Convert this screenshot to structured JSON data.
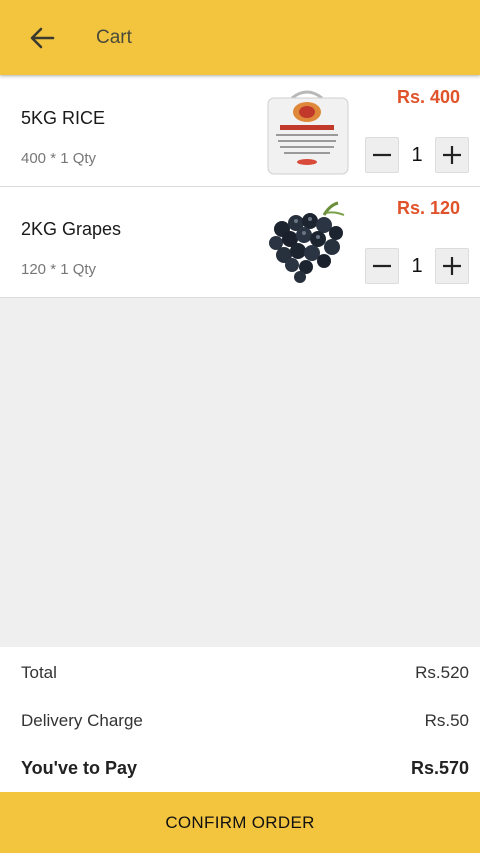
{
  "header": {
    "title": "Cart",
    "back_icon": "arrow-left-icon",
    "background_color": "#f3c53f"
  },
  "cart": {
    "items": [
      {
        "name": "5KG RICE",
        "qty_line": "400 * 1 Qty",
        "price": "Rs. 400",
        "quantity": "1",
        "image_icon": "rice-bag-image"
      },
      {
        "name": "2KG Grapes",
        "qty_line": "120 * 1 Qty",
        "price": "Rs. 120",
        "quantity": "1",
        "image_icon": "grapes-image"
      }
    ],
    "price_color": "#e0522a"
  },
  "summary": {
    "total_label": "Total",
    "total_value": "Rs.520",
    "delivery_label": "Delivery Charge",
    "delivery_value": "Rs.50",
    "pay_label": "You've to Pay",
    "pay_value": "Rs.570"
  },
  "footer": {
    "confirm_label": "CONFIRM ORDER"
  }
}
